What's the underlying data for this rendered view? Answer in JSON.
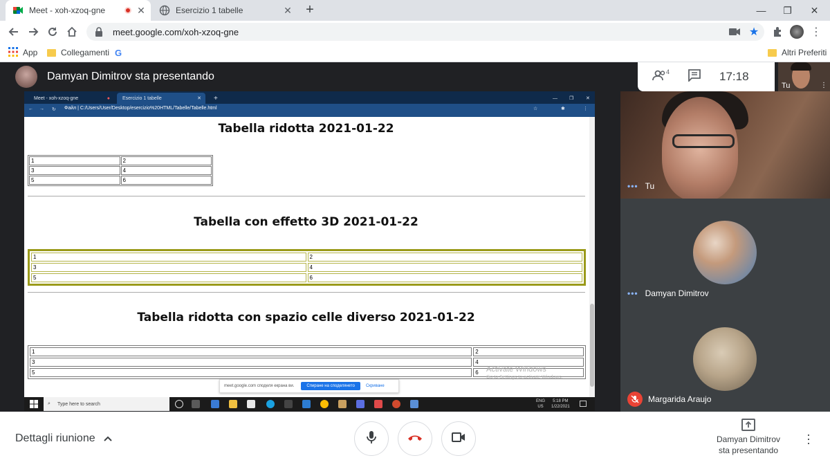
{
  "browser": {
    "tabs": [
      {
        "title": "Meet - xoh-xzoq-gne",
        "active": true,
        "recording": true
      },
      {
        "title": "Esercizio 1 tabelle",
        "active": false
      }
    ],
    "url": "meet.google.com/xoh-xzoq-gne",
    "bookmarks": [
      {
        "label": "App",
        "icon": "apps-grid-icon"
      },
      {
        "label": "Collegamenti",
        "icon": "folder-icon"
      },
      {
        "label": "",
        "icon": "google-icon"
      }
    ],
    "other_bookmarks": "Altri Preferiti"
  },
  "meet": {
    "presenter_banner": "Damyan Dimitrov sta presentando",
    "participants_count": "4",
    "clock": "17:18",
    "self_label": "Tu",
    "participants": [
      {
        "name": "Tu",
        "status": "speaking"
      },
      {
        "name": "Damyan Dimitrov",
        "status": "speaking"
      },
      {
        "name": "Margarida Araujo",
        "status": "muted"
      }
    ],
    "bottom": {
      "details": "Dettagli riunione",
      "present_line1": "Damyan Dimitrov",
      "present_line2": "sta presentando"
    }
  },
  "shared_screen": {
    "tabs": [
      "Meet - xoh-xzoq-gne",
      "Esercizio 1 tabelle"
    ],
    "address": "Файл  |  C:/Users/User/Desktop/esercizio%20HTML/Tabelle/Tabelle.html",
    "headings": [
      "Tabella ridotta 2021-01-22",
      "Tabella con effetto 3D 2021-01-22",
      "Tabella ridotta con spazio celle diverso 2021-01-22"
    ],
    "table_rows": [
      [
        "1",
        "2"
      ],
      [
        "3",
        "4"
      ],
      [
        "5",
        "6"
      ]
    ],
    "watermark_title": "Activate Windows",
    "watermark_sub": "Go to Settings to activate Windows.",
    "sharing_notice": "meet.google.com споделя екрана ви.",
    "stop_sharing": "Спиране на споделянето",
    "hide": "Скриване",
    "taskbar_search": "Type here to search",
    "taskbar_lang": "ENG",
    "taskbar_region": "US",
    "taskbar_time": "5:18 PM",
    "taskbar_date": "1/22/2021"
  }
}
